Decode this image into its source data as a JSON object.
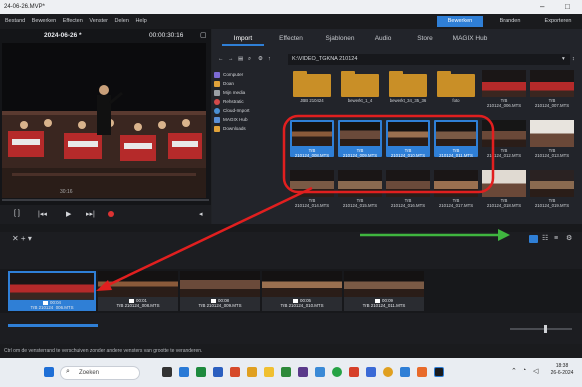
{
  "window": {
    "title": "24-06-26.MVP*",
    "minimize": "–",
    "maximize": "□"
  },
  "menu": [
    "Bestand",
    "Bewerken",
    "Effecten",
    "Venster",
    "Delen",
    "Help"
  ],
  "modes": {
    "edit": "Bewerken",
    "burn": "Branden",
    "export": "Exporteren"
  },
  "preview": {
    "date": "2024-06-26 *",
    "timecode": "00:00:30:16",
    "zoom": "30:16"
  },
  "browser": {
    "tabs": [
      "Import",
      "Effecten",
      "Sjablonen",
      "Audio",
      "Store",
      "MAGIX Hub"
    ],
    "path": "K:\\VIDEO_TGKNA 210124",
    "tree": [
      {
        "label": "Computer",
        "color": "#7c6ad4"
      },
      {
        "label": "Doan",
        "color": "#e0a23a"
      },
      {
        "label": "Mijn media",
        "color": "#9aa0a6"
      },
      {
        "label": "Rehstratic",
        "color": "#d34a4a"
      },
      {
        "label": "Cloud-Import",
        "color": "#4a8fd3"
      },
      {
        "label": "MAGIX Hub",
        "color": "#5a8fd6"
      },
      {
        "label": "Downloads",
        "color": "#e0a23a"
      }
    ],
    "row1": [
      {
        "caption": "JBB  210424",
        "kind": "folder"
      },
      {
        "caption": "bewerkt_1_4",
        "kind": "folder"
      },
      {
        "caption": "bewerkt_34_35_36",
        "kind": "folder"
      },
      {
        "caption": "foto",
        "kind": "folder"
      },
      {
        "caption": "TrB\n210124_006.MTS",
        "kind": "video"
      },
      {
        "caption": "TrB\n210124_007.MTS",
        "kind": "video"
      }
    ],
    "row2": [
      {
        "caption": "TrB\n210124_008.MTS",
        "kind": "selected"
      },
      {
        "caption": "TrB\n210124_009.MTS",
        "kind": "selected"
      },
      {
        "caption": "TrB\n210124_010.MTS",
        "kind": "selected"
      },
      {
        "caption": "TrB\n210124_011.MTS",
        "kind": "selected"
      },
      {
        "caption": "TrB\n210124_012.MTS",
        "kind": "video"
      },
      {
        "caption": "TrB\n210124_013.MTS",
        "kind": "video"
      }
    ],
    "row3": [
      {
        "caption": "TrB\n210124_014.MTS",
        "kind": "video"
      },
      {
        "caption": "TrB\n210124_015.MTS",
        "kind": "video"
      },
      {
        "caption": "TrB\n210124_016.MTS",
        "kind": "video"
      },
      {
        "caption": "TrB\n210124_017.MTS",
        "kind": "video"
      },
      {
        "caption": "TrB\n210124_018.MTS",
        "kind": "video"
      },
      {
        "caption": "TrB\n210124_019.MTS",
        "kind": "video"
      }
    ]
  },
  "timeline": {
    "header": "✕  +  ▾",
    "clips": [
      {
        "time": "00:04",
        "name": "TrB 210124_006.MTS"
      },
      {
        "time": "00:01",
        "name": "TrB 210124_008.MTS"
      },
      {
        "time": "00:08",
        "name": "TrB 210124_009.MTS"
      },
      {
        "time": "00:05",
        "name": "TrB 210124_010.MTS"
      },
      {
        "time": "00:09",
        "name": "TrB 210124_011.MTS"
      }
    ]
  },
  "status": "Ctrl om de vensterrand te verschuiven zonder andere vensters van grootte te veranderen.",
  "taskbar": {
    "search": "Zoeken",
    "time": "18:38",
    "date": "26-6-2024"
  },
  "colors": {
    "accent": "#2f7fd6",
    "annotation_red": "#e11f1f",
    "annotation_green": "#3fb53f"
  }
}
